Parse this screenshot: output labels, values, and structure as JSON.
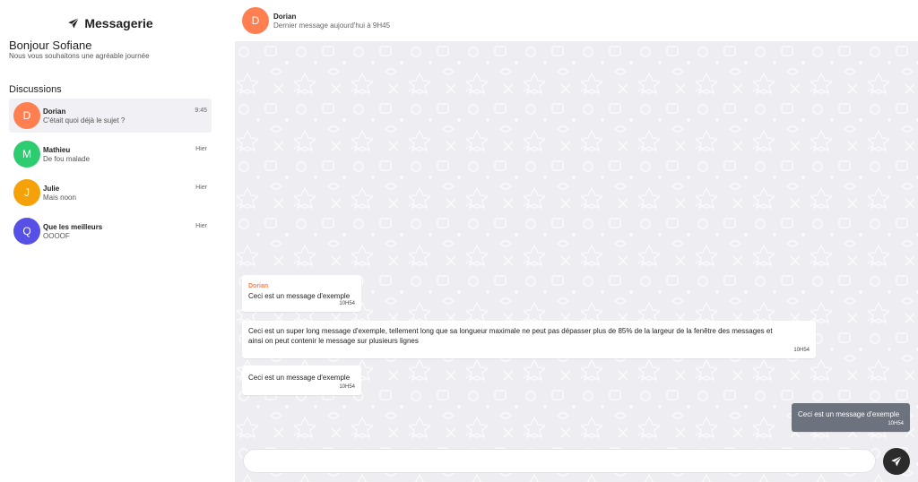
{
  "sidebar": {
    "brand": "Messagerie",
    "greeting": "Bonjour Sofiane",
    "subgreeting": "Nous vous souhaitons une agréable journée",
    "discussions_label": "Discussions",
    "conversations": [
      {
        "initial": "D",
        "name": "Dorian",
        "preview": "C'était quoi déjà le sujet ?",
        "time": "9:45",
        "color": "#ff7f50",
        "active": true
      },
      {
        "initial": "M",
        "name": "Mathieu",
        "preview": "De fou malade",
        "time": "Hier",
        "color": "#2ecc71",
        "active": false
      },
      {
        "initial": "J",
        "name": "Julie",
        "preview": "Mais noon",
        "time": "Hier",
        "color": "#f5a20a",
        "active": false
      },
      {
        "initial": "Q",
        "name": "Que les meilleurs",
        "preview": "OOOOF",
        "time": "Hier",
        "color": "#5650e6",
        "active": false
      }
    ]
  },
  "chat": {
    "header": {
      "initial": "D",
      "name": "Dorian",
      "status": "Dernier message aujourd'hui à 9H45"
    },
    "messages": [
      {
        "sender": "Dorian",
        "text": "Ceci est un message d'exemple",
        "time": "10H54"
      },
      {
        "text_line1": "Ceci est un super long message d'exemple, tellement long que sa longueur maximale ne peut pas  dépasser plus de 85% de la largeur de la fenêtre des messages et",
        "text_line2": "ainsi on peut contenir le message sur plusieurs lignes",
        "time": "10H54"
      },
      {
        "text": "Ceci est un message d'exemple",
        "time": "10H54"
      },
      {
        "text": "Ceci est un message d'exemple",
        "time": "10H54"
      }
    ],
    "composer": {
      "value": "",
      "placeholder": ""
    }
  }
}
